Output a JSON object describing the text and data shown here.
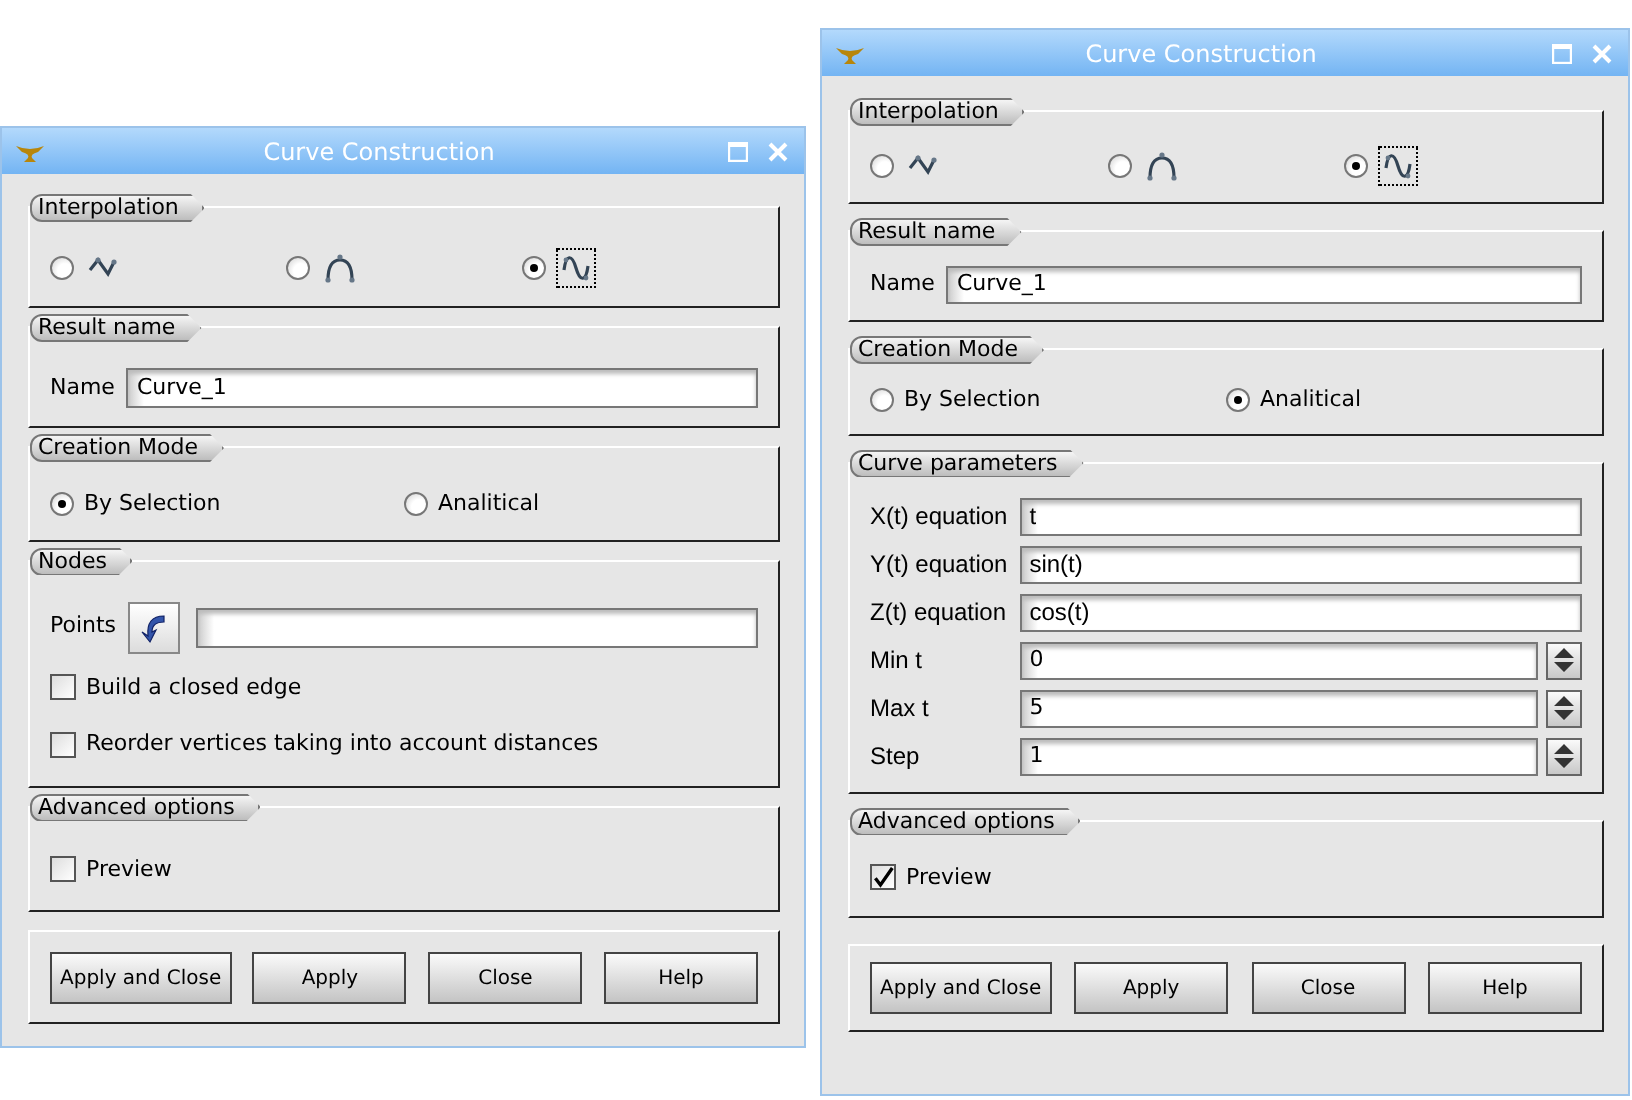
{
  "windows": [
    {
      "title": "Curve Construction",
      "sections": [
        {
          "kind": "options",
          "title": "Interpolation",
          "items": [
            {
              "kind": "radio",
              "selected": false,
              "focused": false
            },
            {
              "kind": "radio",
              "selected": false,
              "focused": false
            },
            {
              "kind": "radio",
              "selected": true,
              "focused": true
            }
          ]
        },
        {
          "kind": "form",
          "title": "Result name",
          "items": [
            {
              "kind": "field",
              "label": "Name",
              "value": "Curve_1"
            }
          ]
        },
        {
          "kind": "options",
          "title": "Creation Mode",
          "items": [
            {
              "kind": "radio",
              "label": "By Selection",
              "selected": true
            },
            {
              "kind": "radio",
              "label": "Analitical",
              "selected": false
            }
          ]
        },
        {
          "kind": "form",
          "title": "Nodes",
          "items": [
            {
              "kind": "picker",
              "label": "Points"
            },
            {
              "kind": "checkbox",
              "label": "Build a closed edge",
              "checked": false
            },
            {
              "kind": "checkbox",
              "label": "Reorder vertices taking into account distances",
              "checked": false
            }
          ]
        },
        {
          "kind": "form",
          "title": "Advanced options",
          "items": [
            {
              "kind": "checkbox",
              "label": "Preview",
              "checked": false
            }
          ]
        }
      ],
      "buttons": [
        "Apply and Close",
        "Apply",
        "Close",
        "Help"
      ]
    },
    {
      "title": "Curve Construction",
      "sections": [
        {
          "kind": "options",
          "title": "Interpolation",
          "items": [
            {
              "kind": "radio",
              "selected": false,
              "focused": false
            },
            {
              "kind": "radio",
              "selected": false,
              "focused": false
            },
            {
              "kind": "radio",
              "selected": true,
              "focused": true
            }
          ]
        },
        {
          "kind": "form",
          "title": "Result name",
          "items": [
            {
              "kind": "field",
              "label": "Name",
              "value": "Curve_1"
            }
          ]
        },
        {
          "kind": "options",
          "title": "Creation Mode",
          "items": [
            {
              "kind": "radio",
              "label": "By Selection",
              "selected": false
            },
            {
              "kind": "radio",
              "label": "Analitical",
              "selected": true
            }
          ]
        },
        {
          "kind": "form",
          "title": "Curve parameters",
          "items": [
            {
              "kind": "field",
              "label": "X(t) equation",
              "value": "t"
            },
            {
              "kind": "field",
              "label": "Y(t) equation",
              "value": "sin(t)"
            },
            {
              "kind": "field",
              "label": "Z(t) equation",
              "value": "cos(t)"
            },
            {
              "kind": "spin",
              "label": "Min t",
              "value": "0"
            },
            {
              "kind": "spin",
              "label": "Max t",
              "value": "5"
            },
            {
              "kind": "spin",
              "label": "Step",
              "value": "1"
            }
          ]
        },
        {
          "kind": "form",
          "title": "Advanced options",
          "items": [
            {
              "kind": "checkbox",
              "label": "Preview",
              "checked": true
            }
          ]
        }
      ],
      "buttons": [
        "Apply and Close",
        "Apply",
        "Close",
        "Help"
      ]
    }
  ]
}
